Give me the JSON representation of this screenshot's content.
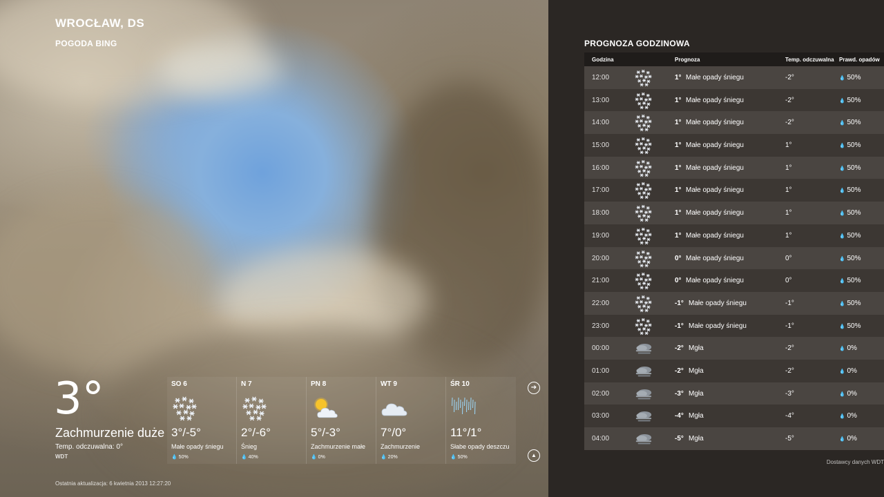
{
  "location": {
    "city": "WROCŁAW, DS",
    "app": "POGODA BING"
  },
  "current": {
    "temp": "3°",
    "condition": "Zachmurzenie duże",
    "feels_like": "Temp. odczuwalna: 0°",
    "source": "WDT",
    "last_update": "Ostatnia aktualizacja: 6 kwietnia 2013 12:27:20"
  },
  "days": [
    {
      "name": "SO 6",
      "temp": "3°/-5°",
      "condition": "Małe opady śniegu",
      "precip": "50%",
      "icon": "snow-icon"
    },
    {
      "name": "N 7",
      "temp": "2°/-6°",
      "condition": "Śnieg",
      "precip": "40%",
      "icon": "snow-icon"
    },
    {
      "name": "PN 8",
      "temp": "5°/-3°",
      "condition": "Zachmurzenie małe",
      "precip": "0%",
      "icon": "partly-sunny-icon"
    },
    {
      "name": "WT 9",
      "temp": "7°/0°",
      "condition": "Zachmurzenie",
      "precip": "20%",
      "icon": "cloudy-icon"
    },
    {
      "name": "ŚR 10",
      "temp": "11°/1°",
      "condition": "Słabe opady deszczu",
      "precip": "50%",
      "icon": "rain-icon"
    }
  ],
  "nav": {
    "next": "➔",
    "up": "▲"
  },
  "hourly": {
    "title": "PROGNOZA GODZINOWA",
    "headers": {
      "time": "Godzina",
      "forecast": "Prognoza",
      "feels": "Temp. odczuwalna",
      "precip": "Prawd. opadów"
    },
    "rows": [
      {
        "time": "12:00",
        "temp": "1°",
        "cond": "Małe opady śniegu",
        "feels": "-2°",
        "prob": "50%",
        "icon": "snow-icon"
      },
      {
        "time": "13:00",
        "temp": "1°",
        "cond": "Małe opady śniegu",
        "feels": "-2°",
        "prob": "50%",
        "icon": "snow-icon"
      },
      {
        "time": "14:00",
        "temp": "1°",
        "cond": "Małe opady śniegu",
        "feels": "-2°",
        "prob": "50%",
        "icon": "snow-icon"
      },
      {
        "time": "15:00",
        "temp": "1°",
        "cond": "Małe opady śniegu",
        "feels": "1°",
        "prob": "50%",
        "icon": "snow-icon"
      },
      {
        "time": "16:00",
        "temp": "1°",
        "cond": "Małe opady śniegu",
        "feels": "1°",
        "prob": "50%",
        "icon": "snow-icon"
      },
      {
        "time": "17:00",
        "temp": "1°",
        "cond": "Małe opady śniegu",
        "feels": "1°",
        "prob": "50%",
        "icon": "snow-icon"
      },
      {
        "time": "18:00",
        "temp": "1°",
        "cond": "Małe opady śniegu",
        "feels": "1°",
        "prob": "50%",
        "icon": "snow-icon"
      },
      {
        "time": "19:00",
        "temp": "1°",
        "cond": "Małe opady śniegu",
        "feels": "1°",
        "prob": "50%",
        "icon": "snow-icon"
      },
      {
        "time": "20:00",
        "temp": "0°",
        "cond": "Małe opady śniegu",
        "feels": "0°",
        "prob": "50%",
        "icon": "snow-icon"
      },
      {
        "time": "21:00",
        "temp": "0°",
        "cond": "Małe opady śniegu",
        "feels": "0°",
        "prob": "50%",
        "icon": "snow-icon"
      },
      {
        "time": "22:00",
        "temp": "-1°",
        "cond": "Małe opady śniegu",
        "feels": "-1°",
        "prob": "50%",
        "icon": "snow-icon"
      },
      {
        "time": "23:00",
        "temp": "-1°",
        "cond": "Małe opady śniegu",
        "feels": "-1°",
        "prob": "50%",
        "icon": "snow-icon"
      },
      {
        "time": "00:00",
        "temp": "-2°",
        "cond": "Mgła",
        "feels": "-2°",
        "prob": "0%",
        "icon": "fog-icon"
      },
      {
        "time": "01:00",
        "temp": "-2°",
        "cond": "Mgła",
        "feels": "-2°",
        "prob": "0%",
        "icon": "fog-icon"
      },
      {
        "time": "02:00",
        "temp": "-3°",
        "cond": "Mgła",
        "feels": "-3°",
        "prob": "0%",
        "icon": "fog-icon"
      },
      {
        "time": "03:00",
        "temp": "-4°",
        "cond": "Mgła",
        "feels": "-4°",
        "prob": "0%",
        "icon": "fog-icon"
      },
      {
        "time": "04:00",
        "temp": "-5°",
        "cond": "Mgła",
        "feels": "-5°",
        "prob": "0%",
        "icon": "fog-icon"
      }
    ],
    "provider": "Dostawcy danych WDT"
  }
}
